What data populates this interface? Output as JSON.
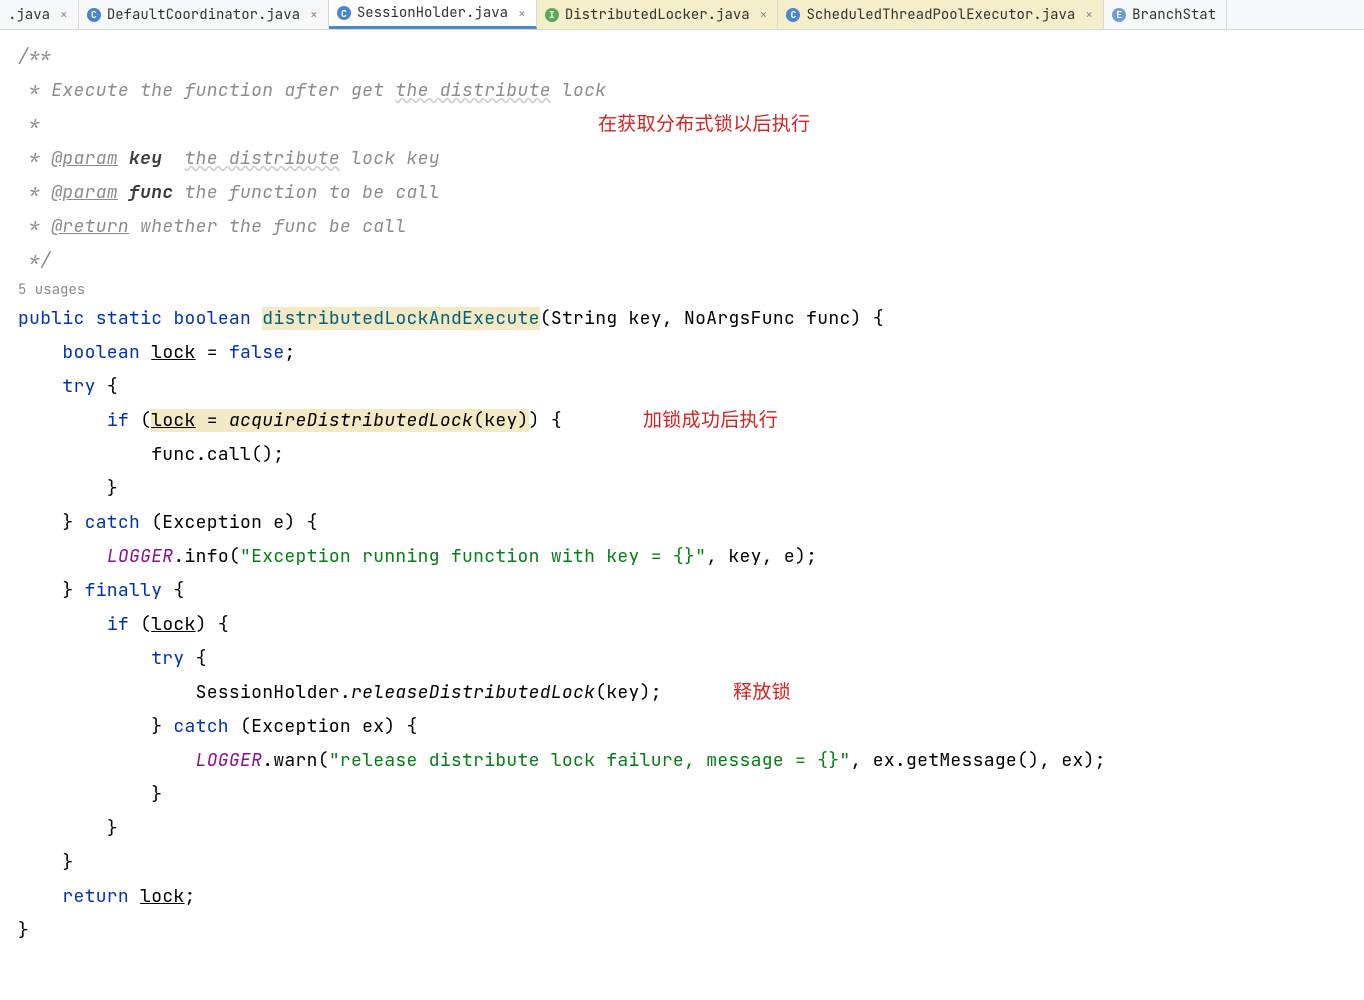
{
  "tabs": [
    {
      "label": ".java",
      "iconType": "",
      "active": false,
      "highlighted": false
    },
    {
      "label": "DefaultCoordinator.java",
      "iconType": "class",
      "active": false,
      "highlighted": false
    },
    {
      "label": "SessionHolder.java",
      "iconType": "class",
      "active": true,
      "highlighted": false
    },
    {
      "label": "DistributedLocker.java",
      "iconType": "interface",
      "active": false,
      "highlighted": true
    },
    {
      "label": "ScheduledThreadPoolExecutor.java",
      "iconType": "class",
      "active": false,
      "highlighted": true
    },
    {
      "label": "BranchStat",
      "iconType": "enum",
      "active": false,
      "highlighted": false
    }
  ],
  "iconLetters": {
    "class": "C",
    "interface": "I",
    "enum": "E"
  },
  "usages": "5 usages",
  "annotations": {
    "a1": "在获取分布式锁以后执行",
    "a2": "加锁成功后执行",
    "a3": "释放锁"
  },
  "code": {
    "c1": "/**",
    "c2_1": " * Execute the function after get ",
    "c2_2": "the distribute",
    "c2_3": " lock",
    "c3": " *",
    "c4_1": " * ",
    "c4_tag": "@param",
    "c4_name": " key",
    "c4_2": "  ",
    "c4_3": "the distribute",
    "c4_4": " lock key",
    "c5_1": " * ",
    "c5_tag": "@param",
    "c5_name": " func",
    "c5_2": " the function to be call",
    "c6_1": " * ",
    "c6_tag": "@return",
    "c6_2": " whether the func be call",
    "c7": " */",
    "l1_public": "public",
    "l1_static": "static",
    "l1_boolean": "boolean",
    "l1_method": "distributedLockAndExecute",
    "l1_params": "(String key, NoArgsFunc func) {",
    "l2_boolean": "boolean",
    "l2_lock": "lock",
    "l2_rest": " = ",
    "l2_false": "false",
    "l2_semi": ";",
    "l3_try": "try",
    "l3_brace": " {",
    "l4_if": "if",
    "l4_open": " (",
    "l4_lock": "lock",
    "l4_eq": " = ",
    "l4_call": "acquireDistributedLock",
    "l4_args": "(key)",
    "l4_close": ") {",
    "l5": "func.call();",
    "l6": "}",
    "l7_close": "} ",
    "l7_catch": "catch",
    "l7_rest": " (Exception e) {",
    "l8_logger": "LOGGER",
    "l8_info": ".info(",
    "l8_str": "\"Exception running function with key = {}\"",
    "l8_rest": ", key, e);",
    "l9_close": "} ",
    "l9_finally": "finally",
    "l9_brace": " {",
    "l10_if": "if",
    "l10_open": " (",
    "l10_lock": "lock",
    "l10_close": ") {",
    "l11_try": "try",
    "l11_brace": " {",
    "l12_1": "SessionHolder.",
    "l12_call": "releaseDistributedLock",
    "l12_2": "(key);",
    "l13_close": "} ",
    "l13_catch": "catch",
    "l13_rest": " (Exception ex) {",
    "l14_logger": "LOGGER",
    "l14_warn": ".warn(",
    "l14_str": "\"release distribute lock failure, message = {}\"",
    "l14_rest": ", ex.getMessage(), ex);",
    "l15": "}",
    "l16": "}",
    "l17": "}",
    "l18_return": "return",
    "l18_sp": " ",
    "l18_lock": "lock",
    "l18_semi": ";",
    "l19": "}"
  }
}
